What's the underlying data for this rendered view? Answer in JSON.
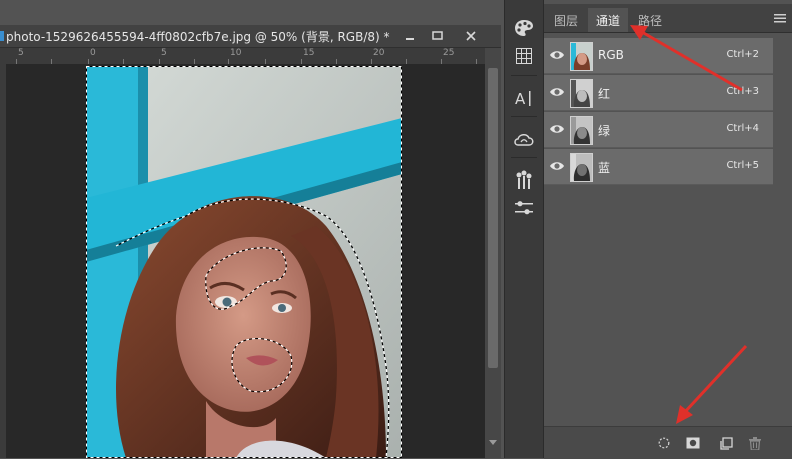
{
  "document": {
    "title": "photo-1529626455594-4ff0802cfb7e.jpg @ 50% (背景, RGB/8) *",
    "ruler_top": [
      "5",
      "0",
      "5",
      "10",
      "15",
      "20",
      "25"
    ]
  },
  "panel": {
    "tabs": [
      "图层",
      "通道",
      "路径"
    ],
    "active_tab": "通道",
    "channels": [
      {
        "name": "RGB",
        "shortcut": "Ctrl+2"
      },
      {
        "name": "红",
        "shortcut": "Ctrl+3"
      },
      {
        "name": "绿",
        "shortcut": "Ctrl+4"
      },
      {
        "name": "蓝",
        "shortcut": "Ctrl+5"
      }
    ]
  },
  "tools": [
    "color-palette-icon",
    "grid-icon",
    "character-icon",
    "cc-libraries-icon",
    "brush-presets-icon",
    "adjustments-icon"
  ],
  "panel_buttons": [
    "load-channel-as-selection-icon",
    "save-selection-as-channel-icon",
    "new-channel-icon",
    "delete-channel-icon"
  ],
  "colors": {
    "accent_arrow": "#e0302a",
    "panel_bg": "#535353",
    "row_bg": "#6b6b6b"
  }
}
